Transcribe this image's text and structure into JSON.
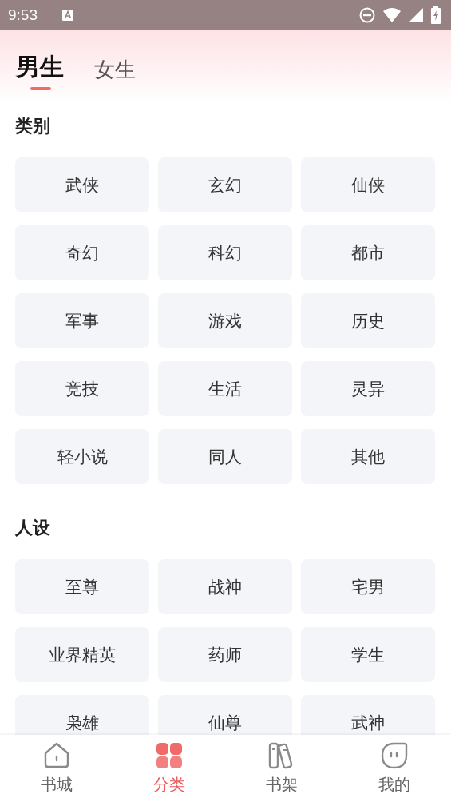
{
  "status_bar": {
    "time": "9:53"
  },
  "gender_tabs": [
    {
      "label": "男生",
      "selected": true
    },
    {
      "label": "女生",
      "selected": false
    }
  ],
  "sections": [
    {
      "title": "类别",
      "items": [
        "武侠",
        "玄幻",
        "仙侠",
        "奇幻",
        "科幻",
        "都市",
        "军事",
        "游戏",
        "历史",
        "竞技",
        "生活",
        "灵异",
        "轻小说",
        "同人",
        "其他"
      ]
    },
    {
      "title": "人设",
      "items": [
        "至尊",
        "战神",
        "宅男",
        "业界精英",
        "药师",
        "学生",
        "枭雄",
        "仙尊",
        "武神"
      ]
    }
  ],
  "bottom_nav": [
    {
      "label": "书城",
      "selected": false
    },
    {
      "label": "分类",
      "selected": true
    },
    {
      "label": "书架",
      "selected": false
    },
    {
      "label": "我的",
      "selected": false
    }
  ]
}
